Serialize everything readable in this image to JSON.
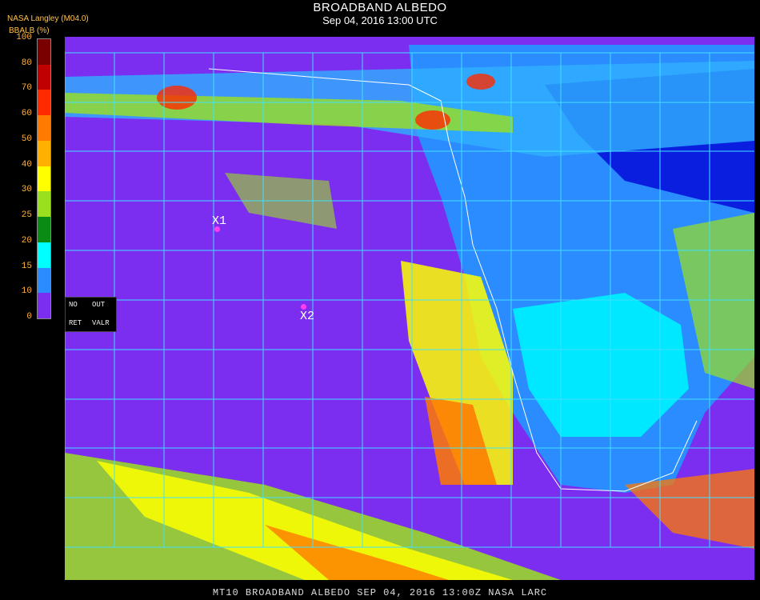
{
  "header": {
    "title": "BROADBAND ALBEDO",
    "subtitle": "Sep 04, 2016 13:00 UTC",
    "credit": "NASA Langley (M04.0)",
    "colorbar_label": "BBALB (%)"
  },
  "colorbar": {
    "ticks": [
      "100",
      "80",
      "70",
      "60",
      "50",
      "40",
      "30",
      "25",
      "20",
      "15",
      "10",
      "0"
    ],
    "colors": [
      "#7a0000",
      "#c00000",
      "#ff2a00",
      "#ff7a00",
      "#ffb000",
      "#ffff00",
      "#9be01e",
      "#0a8c14",
      "#00ffff",
      "#2a8cff",
      "#0a1ee0",
      "#7b2df0"
    ]
  },
  "status_box": {
    "no": "NO",
    "out": "OUT",
    "ret": "RET",
    "valr": "VALR"
  },
  "markers": {
    "x1": "X1",
    "x2": "X2"
  },
  "footer": "MT10  BROADBAND ALBEDO   SEP 04, 2016 13:00Z   NASA LARC",
  "colors": {
    "ocean_low": "#7b2df0",
    "land_mid": "#2a8cff",
    "land_high": "#00ffff",
    "cloud": "#ffff00",
    "grid": "#40e0ff",
    "marker": "#ff3df0"
  }
}
